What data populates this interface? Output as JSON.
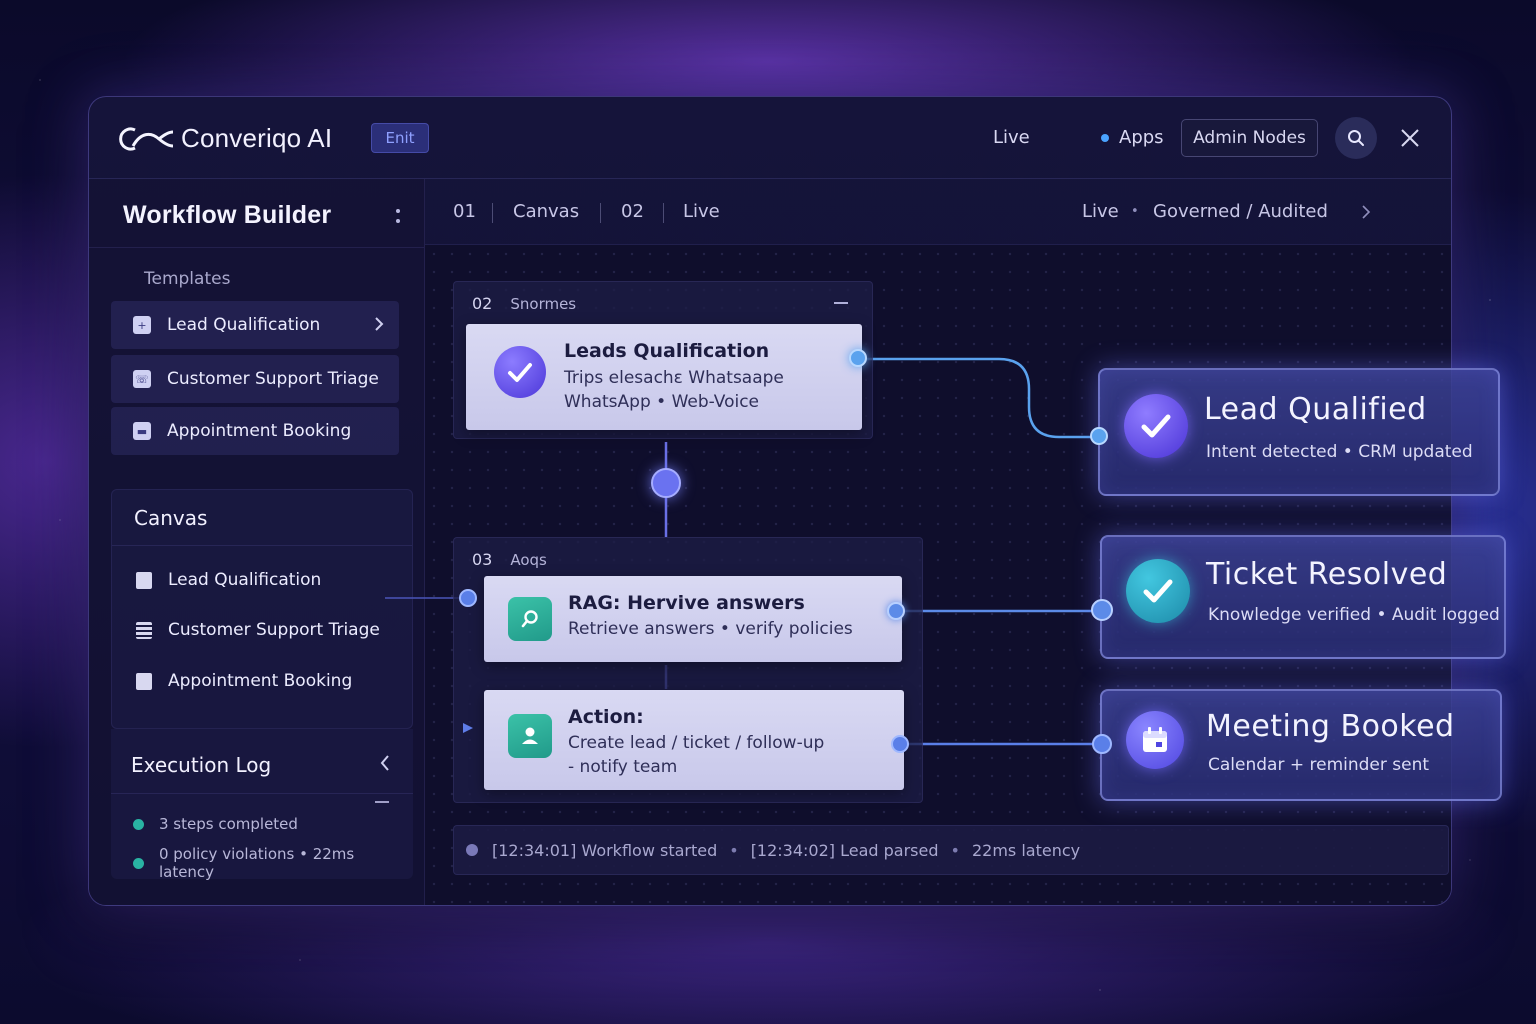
{
  "app": {
    "brand": "Converiqo AI",
    "edit_badge": "Enit"
  },
  "topbar": {
    "live": "Live",
    "apps": "Apps",
    "admin_nodes": "Admin Nodes"
  },
  "sidebar": {
    "title": "Workflow Builder",
    "templates_label": "Templates",
    "templates": [
      {
        "label": "Lead Qualification"
      },
      {
        "label": "Customer Support Triage"
      },
      {
        "label": "Appointment Booking"
      }
    ],
    "canvas": {
      "title": "Canvas",
      "items": [
        {
          "label": "Lead Qualification"
        },
        {
          "label": "Customer Support Triage"
        },
        {
          "label": "Appointment Booking"
        }
      ]
    },
    "execution_log": {
      "title": "Execution Log",
      "rows": [
        {
          "text": "3 steps completed"
        },
        {
          "text": "0 policy violations • 22ms latency"
        }
      ]
    }
  },
  "breadcrumb": {
    "step1": "01",
    "step1_label": "Canvas",
    "step2": "02",
    "step2_label": "Live",
    "status": "Live",
    "status_sep": "•",
    "governance": "Governed / Audited"
  },
  "nodes": {
    "group1": {
      "number": "02",
      "name": "Snormes"
    },
    "lead_card": {
      "title": "Leads Qualification",
      "line1": "Trips elesachε Whatsaape",
      "line2": "WhatsApp • Web-Voice"
    },
    "group2": {
      "number": "03",
      "name": "Aoqs"
    },
    "rag_card": {
      "title": "RAG: Hervive answers",
      "line1": "Retrieve answers • verify policies"
    },
    "action_card": {
      "title": "Action:",
      "line1": "Create lead / ticket / follow-up",
      "line2": "- notify team"
    }
  },
  "outcomes": [
    {
      "title": "Lead Qualified",
      "subtitle": "Intent detected • CRM updated"
    },
    {
      "title": "Ticket Resolved",
      "subtitle": "Knowledge verified • Audit logged"
    },
    {
      "title": "Meeting Booked",
      "subtitle": "Calendar + reminder sent"
    }
  ],
  "log": {
    "entry1": "[12:34:01] Workflow started",
    "sep1": "•",
    "entry2": "[12:34:02] Lead parsed",
    "sep2": "•",
    "entry3": "22ms latency"
  },
  "colors": {
    "accent": "#6b6cf2",
    "teal": "#29b3a3",
    "background": "#0f0e2c"
  }
}
